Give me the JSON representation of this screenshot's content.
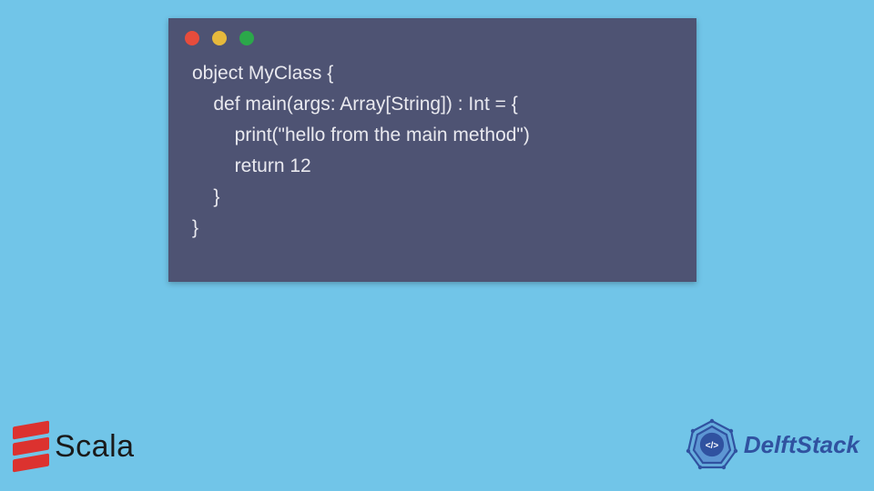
{
  "code": {
    "line1": "object MyClass {",
    "line2": "    def main(args: Array[String]) : Int = {",
    "line3": "        print(\"hello from the main method\")",
    "line4": "        return 12",
    "line5": "    }",
    "line6": "}"
  },
  "logos": {
    "scala": "Scala",
    "delftstack": "DelftStack"
  },
  "colors": {
    "background": "#71c5e8",
    "window": "#4e5373",
    "code_text": "#e9e9ef",
    "scala_red": "#dc322f",
    "delft_blue": "#3052a0"
  }
}
